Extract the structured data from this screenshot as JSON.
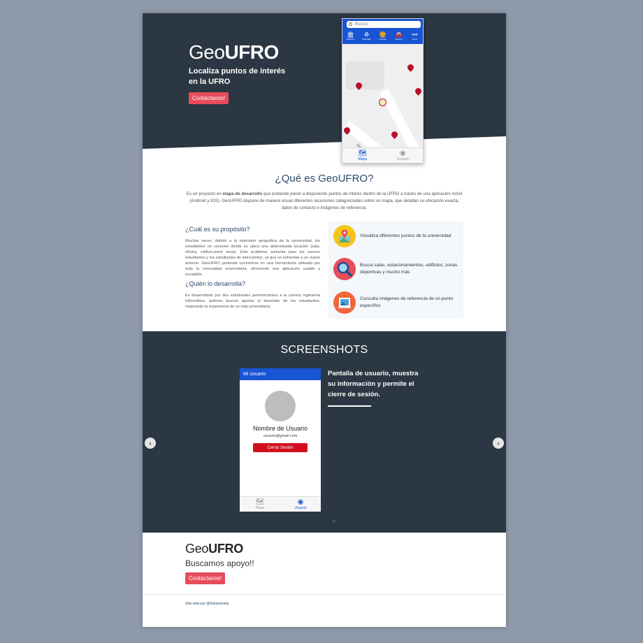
{
  "hero": {
    "brand_light": "Geo",
    "brand_bold": "UFRO",
    "tagline": "Localiza puntos de interés en la UFRO",
    "contact_label": "Contáctanos!"
  },
  "phone_map": {
    "search_placeholder": "Buscar",
    "categories": [
      {
        "icon": "bank-icon",
        "label": "Edificios"
      },
      {
        "icon": "recycle-icon",
        "label": "Reciclaje"
      },
      {
        "icon": "food-icon",
        "label": "Comida"
      },
      {
        "icon": "car-icon",
        "label": "Parking"
      },
      {
        "icon": "more-icon",
        "label": "Otros"
      }
    ],
    "street_label": "Montevideo",
    "nav": {
      "map": "Mapa",
      "user": "Usuario"
    }
  },
  "about": {
    "title": "¿Qué es GeoUFRO?",
    "desc_before": "Es un proyecto en ",
    "desc_bold": "etapa de desarrollo",
    "desc_after": " que pretende poner a disposición puntos de interés dentro de la UFRO a través de una aplicación móvil (Android y IOS). GeoUFRO dispone de manera visual diferentes locaciones categorizadas sobre un mapa, que detallan su ubicación exacta, datos de contacto e imágenes de referencia.",
    "purpose_title": "¿Cuál es su propósito?",
    "purpose_text": "Muchas veces, debido a la extensión geográfica de la universidad, los estudiantes no conocen dónde se ubica una determinada locación (sala, oficina, edificio,entre otros). Este problema aumenta para los nuevos estudiantes y los estudiantes de intercambio, ya que se enfrentan a un nuevo entorno. GeoUFRO pretende convertirse en una herramienta utilizada por toda la comunidad universitaria, ofreciendo una aplicación usable y escalable.",
    "dev_title": "¿Quién lo desarrolla?",
    "dev_text": "Es desarrollado por dos estudiantes pertenecientes a la carrera Ingeniería Informática, quiénes buscan aportar al bienestar de los estudiantes, mejorando la experiencia de su vida universitaria.",
    "features": [
      {
        "text": "Visualiza diferentes puntos de la universidad",
        "icon": "map-pin-icon",
        "color": "#f5c518"
      },
      {
        "text": "Busca salas, estacionamientos, edificios, zonas deportivas y mucho más",
        "icon": "magnifier-icon",
        "color": "#e74c5a"
      },
      {
        "text": "Consulta imágenes de referencia de un punto específico",
        "icon": "picture-icon",
        "color": "#f0663c"
      }
    ]
  },
  "screenshots": {
    "title": "SCREENSHOTS",
    "phone_header": "Mi usuario",
    "user_name": "Nombre de Usuario",
    "user_email": "usuario@gmail.com",
    "logout_label": "Cerrar Sesión",
    "nav": {
      "map": "Mapa",
      "user": "Usuario"
    },
    "caption": "Pantalla de usuario, muestra su información y permite el cierre de sesión.",
    "prev_arrow": "‹",
    "next_arrow": "›"
  },
  "footer": {
    "brand_light": "Geo",
    "brand_bold": "UFRO",
    "subtitle": "Buscamos apoyo!!",
    "contact_label": "Contáctanos!",
    "credits": "Sitio web por @heberarratia"
  },
  "colors": {
    "dark": "#2b3742",
    "accent": "#e74c5a",
    "blue": "#1854d4"
  }
}
